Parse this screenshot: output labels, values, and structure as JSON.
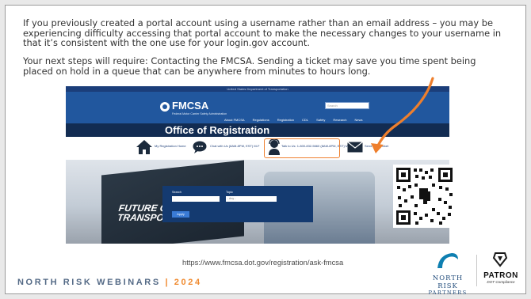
{
  "slide": {
    "paragraph1": "If you previously created a portal account using a username rather than an email address – you may be experiencing difficulty accessing that portal account to make the necessary changes to your username in that it’s consistent with the one use for your login.gov account.",
    "paragraph2": "Your next steps will require: Contacting the FMCSA. Sending a ticket may save you time spent being placed on hold in a queue that can be anywhere from minutes to hours long.",
    "url": "https://www.fmcsa.dot.gov/registration/ask-fmcsa",
    "footer_brand": "NORTH RISK WEBINARS",
    "footer_sep": "|",
    "footer_year": "2024",
    "logo_nrp_line1": "NORTH RISK",
    "logo_nrp_line2": "PARTNERS",
    "logo_patron": "PATRON",
    "logo_patron_sub": "DOT Compliance"
  },
  "website": {
    "gov_banner": "United States Department of Transportation",
    "logo": "FMCSA",
    "logo_sub": "Federal Motor Carrier Safety Administration",
    "search_placeholder": "Search",
    "nav": [
      "About FMCSA",
      "Regulations",
      "Registration",
      "CDL",
      "Safety",
      "Research",
      "News"
    ],
    "page_title": "Office of Registration",
    "links": {
      "home": "My Registration Home",
      "chat": "Chat with Us (8AM-8PM, EST) M-F",
      "talk": "Talk to Us: 1-800-832-5660 (8AM-8PM, EST) M-F",
      "ticket": "Send Us a Ticket"
    },
    "form": {
      "search_label": "Search",
      "topic_label": "Topic",
      "topic_value": "- Any -",
      "apply": "Apply"
    },
    "hero_text": "FUTURE OF TRANSPORTATION"
  },
  "colors": {
    "fmcsa_blue": "#21579e",
    "title_navy": "#122c52",
    "highlight_orange": "#ee7f2d",
    "footer_blue": "#546a86"
  }
}
